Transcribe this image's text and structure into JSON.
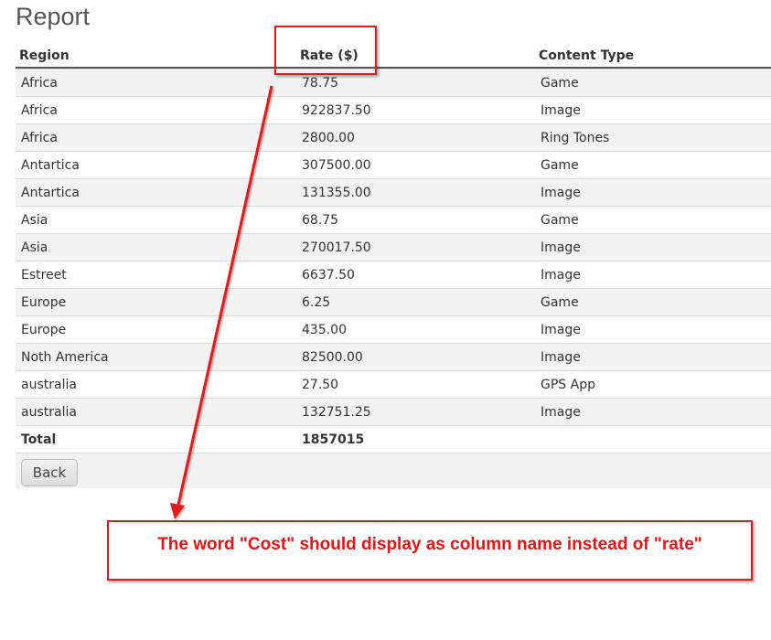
{
  "page": {
    "title": "Report"
  },
  "table": {
    "columns": [
      "Region",
      "Rate ($)",
      "Content Type"
    ],
    "rows": [
      [
        "Africa",
        "78.75",
        "Game"
      ],
      [
        "Africa",
        "922837.50",
        "Image"
      ],
      [
        "Africa",
        "2800.00",
        "Ring Tones"
      ],
      [
        "Antartica",
        "307500.00",
        "Game"
      ],
      [
        "Antartica",
        "131355.00",
        "Image"
      ],
      [
        "Asia",
        "68.75",
        "Game"
      ],
      [
        "Asia",
        "270017.50",
        "Image"
      ],
      [
        "Estreet",
        "6637.50",
        "Image"
      ],
      [
        "Europe",
        "6.25",
        "Game"
      ],
      [
        "Europe",
        "435.00",
        "Image"
      ],
      [
        "Noth America",
        "82500.00",
        "Image"
      ],
      [
        "australia",
        "27.50",
        "GPS App"
      ],
      [
        "australia",
        "132751.25",
        "Image"
      ]
    ],
    "total": {
      "label": "Total",
      "value": "1857015"
    }
  },
  "actions": {
    "back_label": "Back"
  },
  "annotation": {
    "text": "The word \"Cost\"  should display as column name instead of \"rate\"",
    "color": "#e01b1b"
  }
}
